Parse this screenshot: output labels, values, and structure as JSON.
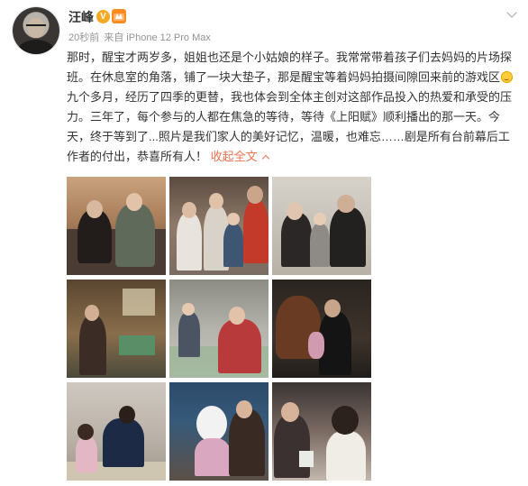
{
  "post": {
    "author": "汪峰",
    "verified_badge": "V",
    "time": "20秒前",
    "source": "来自 iPhone 12 Pro Max",
    "text_part1": "那时，醒宝才两岁多，姐姐也还是个小姑娘的样子。我常常带着孩子们去妈妈的片场探班。在休息室的角落，铺了一块大垫子，那是醒宝等着妈妈拍摄间隙回来前的游戏区",
    "text_part2": "九个多月，经历了四季的更替，我也体会到全体主创对这部作品投入的热爱和承受的压力。三年了，每个参与的人都在焦急的等待，等待《上阳赋》顺利播出的那一天。今天，终于等到了...照片是我们家人的美好记忆，温暖，也难忘……剧是所有台前幕后工作者的付出，恭喜所有人！",
    "collapse_label": "收起全文",
    "photos_count": 9
  },
  "colors": {
    "link": "#eb7350",
    "text": "#333333",
    "meta": "#939393",
    "verified": "#f7a822"
  },
  "icons": [
    "avatar",
    "verified-v-icon",
    "level-badge-icon",
    "chevron-down-icon",
    "smile-emoji-icon",
    "collapse-arrow-icon"
  ]
}
